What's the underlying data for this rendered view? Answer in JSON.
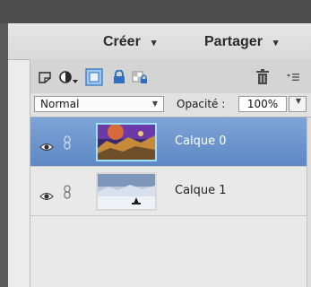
{
  "menu": {
    "create_label": "Créer",
    "share_label": "Partager",
    "caret": "▾"
  },
  "toolbar": {
    "icons": [
      "new-layer-icon",
      "adjustment-layer-icon",
      "mask-icon",
      "lock-icon",
      "lock-transparency-icon",
      "trash-icon",
      "panel-menu-icon"
    ]
  },
  "options": {
    "blend_mode": "Normal",
    "opacity_label": "Opacité :",
    "opacity_value": "100%"
  },
  "layers": [
    {
      "name": "Calque 0",
      "selected": true
    },
    {
      "name": "Calque 1",
      "selected": false
    }
  ],
  "colors": {
    "selected_row": "#6b93cc",
    "trash_icon": "#4a4a4a",
    "toolbar_accent": "#2f6fc0"
  }
}
